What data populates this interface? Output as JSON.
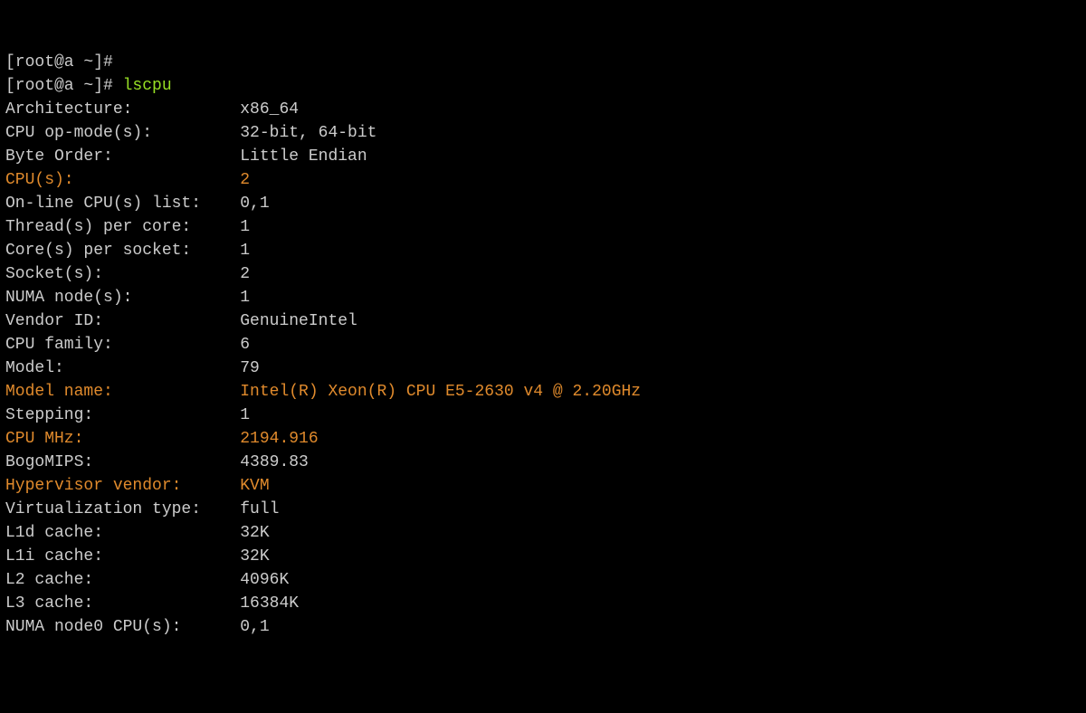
{
  "prompt1": "[root@a ~]#",
  "prompt2": "[root@a ~]# ",
  "command": "lscpu",
  "rows": [
    {
      "label": "Architecture:",
      "value": "x86_64",
      "hl": false
    },
    {
      "label": "CPU op-mode(s):",
      "value": "32-bit, 64-bit",
      "hl": false
    },
    {
      "label": "Byte Order:",
      "value": "Little Endian",
      "hl": false
    },
    {
      "label": "CPU(s):",
      "value": "2",
      "hl": true
    },
    {
      "label": "On-line CPU(s) list:",
      "value": "0,1",
      "hl": false
    },
    {
      "label": "Thread(s) per core:",
      "value": "1",
      "hl": false
    },
    {
      "label": "Core(s) per socket:",
      "value": "1",
      "hl": false
    },
    {
      "label": "Socket(s):",
      "value": "2",
      "hl": false
    },
    {
      "label": "NUMA node(s):",
      "value": "1",
      "hl": false
    },
    {
      "label": "Vendor ID:",
      "value": "GenuineIntel",
      "hl": false
    },
    {
      "label": "CPU family:",
      "value": "6",
      "hl": false
    },
    {
      "label": "Model:",
      "value": "79",
      "hl": false
    },
    {
      "label": "Model name:",
      "value": "Intel(R) Xeon(R) CPU E5-2630 v4 @ 2.20GHz",
      "hl": true
    },
    {
      "label": "Stepping:",
      "value": "1",
      "hl": false
    },
    {
      "label": "CPU MHz:",
      "value": "2194.916",
      "hl": true
    },
    {
      "label": "BogoMIPS:",
      "value": "4389.83",
      "hl": false
    },
    {
      "label": "Hypervisor vendor:",
      "value": "KVM",
      "hl": true
    },
    {
      "label": "Virtualization type:",
      "value": "full",
      "hl": false
    },
    {
      "label": "L1d cache:",
      "value": "32K",
      "hl": false
    },
    {
      "label": "L1i cache:",
      "value": "32K",
      "hl": false
    },
    {
      "label": "L2 cache:",
      "value": "4096K",
      "hl": false
    },
    {
      "label": "L3 cache:",
      "value": "16384K",
      "hl": false
    },
    {
      "label": "NUMA node0 CPU(s):",
      "value": "0,1",
      "hl": false
    }
  ]
}
